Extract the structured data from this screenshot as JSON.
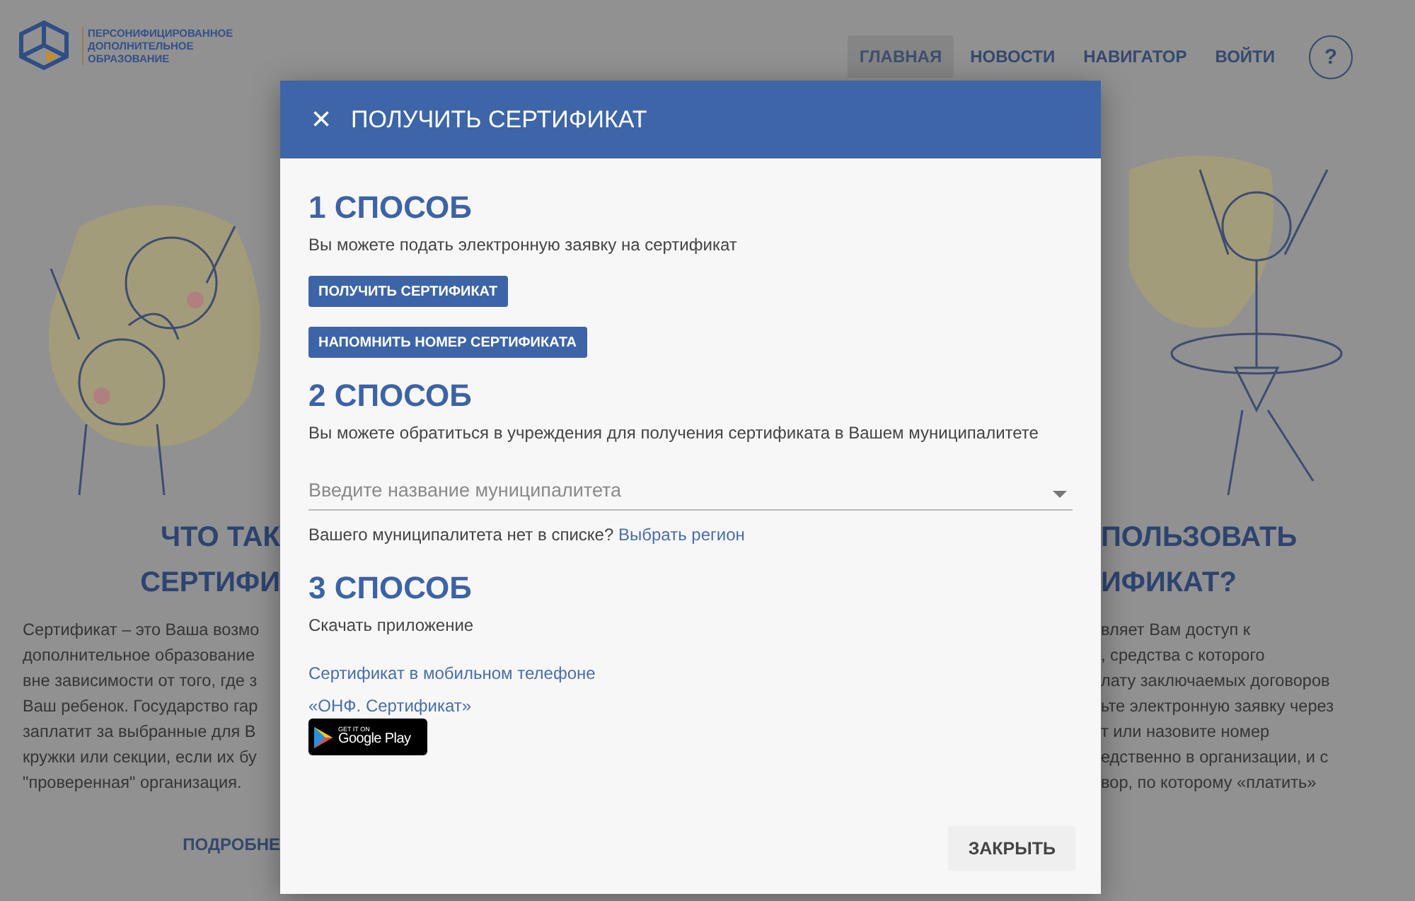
{
  "header": {
    "logo_lines": [
      "ПЕРСОНИФИЦИРОВАННОЕ",
      "ДОПОЛНИТЕЛЬНОЕ",
      "ОБРАЗОВАНИЕ"
    ],
    "nav": [
      {
        "label": "ГЛАВНАЯ",
        "selected": true
      },
      {
        "label": "НОВОСТИ",
        "selected": false
      },
      {
        "label": "НАВИГАТОР",
        "selected": false
      },
      {
        "label": "ВОЙТИ",
        "selected": false
      }
    ],
    "help": "?"
  },
  "background": {
    "left": {
      "heading": [
        "ЧТО ТАК",
        "СЕРТИФИ"
      ],
      "lines": [
        "Сертификат – это Ваша возмо",
        "дополнительное образование",
        "вне зависимости от того, где з",
        "Ваш ребенок. Государство гар",
        "заплатит за выбранные для В",
        "кружки или секции, если их бу",
        "\"проверенная\" организация."
      ],
      "link": "ПОДРОБНЕ"
    },
    "right": {
      "heading": [
        "ПОЛЬЗОВАТЬ",
        "ИФИКАТ?"
      ],
      "lines": [
        "вляет Вам доступ к",
        ", средства с которого",
        "лату заключаемых договоров",
        "ьте электронную заявку через",
        "т или назовите номер",
        "едственно в организации, и с",
        "вор, по которому «платить»"
      ]
    }
  },
  "dialog": {
    "close_icon": "×",
    "title": "ПОЛУЧИТЬ СЕРТИФИКАТ",
    "method_1": {
      "heading": "1 СПОСОБ",
      "text": "Вы можете подать электронную заявку на сертификат",
      "buttons": [
        "ПОЛУЧИТЬ СЕРТИФИКАТ",
        "НАПОМНИТЬ НОМЕР СЕРТИФИКАТА"
      ]
    },
    "method_2": {
      "heading": "2 СПОСОБ",
      "text": "Вы можете обратиться в учреждения для получения сертификата в Вашем муниципалитете",
      "field": {
        "placeholder": "Введите название муниципалитета"
      },
      "note": "Вашего муниципалитета нет в списке?",
      "note_link": "Выбрать регион"
    },
    "method_3": {
      "heading": "3 СПОСОБ",
      "text": "Скачать приложение",
      "links": [
        "Сертификат в мобильном телефоне",
        "«ОНФ. Сертификат»"
      ],
      "badge": {
        "small": "GET IT ON",
        "big": "Google Play"
      }
    },
    "close_button": "ЗАКРЫТЬ"
  }
}
